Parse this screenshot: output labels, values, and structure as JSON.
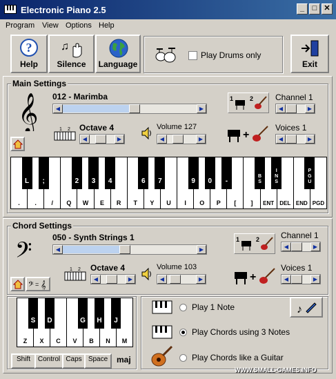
{
  "window": {
    "title": "Electronic Piano 2.5",
    "watermark": "WWW.SMALL-GAMES.INFO"
  },
  "menu": [
    "Program",
    "View",
    "Options",
    "Help"
  ],
  "toolbar": {
    "help_label": "Help",
    "silence_label": "Silence",
    "language_label": "Language",
    "drums_label": "Play Drums only",
    "drums_checked": false,
    "exit_label": "Exit"
  },
  "main": {
    "title": "Main Settings",
    "instrument": "012 - Marimba",
    "octave_label": "Octave 4",
    "volume_label": "Volume 127",
    "channel_label": "Channel 1",
    "voices_label": "Voices 1",
    "octave_numbers": [
      "1",
      "2"
    ],
    "icon_numbers": [
      "1",
      "2"
    ],
    "white_keys": [
      ".",
      ".",
      "/",
      "Q",
      "W",
      "E",
      "R",
      "T",
      "Y",
      "U",
      "I",
      "O",
      "P",
      "[",
      "]",
      "ENT",
      "DEL",
      "END",
      "PGD"
    ],
    "black_keys": [
      "L",
      ";",
      "2",
      "3",
      "4",
      "6",
      "7",
      "9",
      "0",
      "-",
      "BS",
      "INS",
      "PGU"
    ]
  },
  "chord": {
    "title": "Chord Settings",
    "instrument": "050 - Synth Strings 1",
    "octave_label": "Octave 4",
    "volume_label": "Volume 103",
    "channel_label": "Channel 1",
    "voices_label": "Voices 1",
    "octave_numbers": [
      "1",
      "2"
    ],
    "icon_numbers": [
      "1",
      "2"
    ],
    "white_keys": [
      "Z",
      "X",
      "C",
      "V",
      "B",
      "N",
      "M"
    ],
    "black_keys": [
      "S",
      "D",
      "G",
      "H",
      "J"
    ],
    "modifiers": [
      "Shift",
      "Control",
      "Caps",
      "Space"
    ],
    "chord_type": "maj",
    "option1": "Play 1 Note",
    "option2": "Play Chords using 3 Notes",
    "option3": "Play Chords like a Guitar",
    "selected_option": 2
  }
}
